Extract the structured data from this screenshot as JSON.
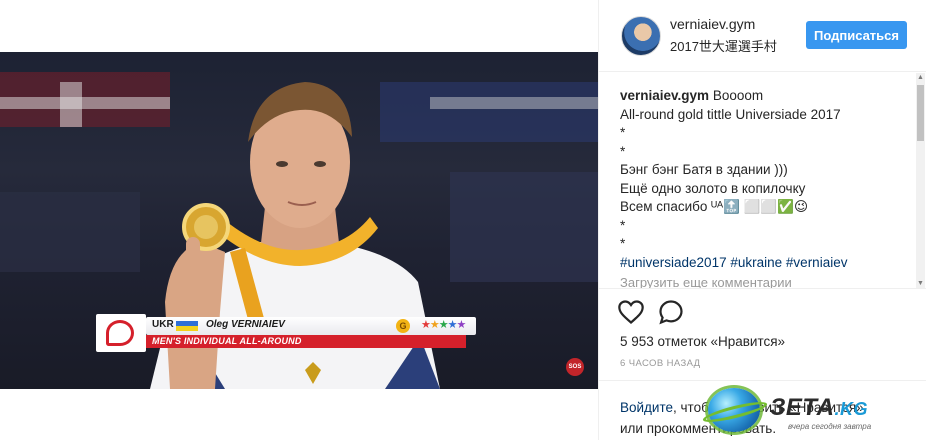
{
  "post": {
    "username": "verniaiev.gym",
    "location": "2017世大運選手村",
    "follow_label": "Подписаться",
    "caption": {
      "user": "verniaiev.gym",
      "first_line": "Boooom",
      "lines": [
        "All-round gold tittle Universiade 2017",
        "*",
        "*",
        "Бэнг бэнг Батя в здании )))",
        "Ещё одно золото в копилочку",
        "Всем спасибо ᵁᴬ🔝 ⬜⬜✅😉",
        "*",
        "*"
      ],
      "hashtags": [
        "#universiade2017",
        "#ukraine",
        "#verniaiev"
      ]
    },
    "load_more": "Загрузить еще комментарии",
    "likes": "5 953 отметок «Нравится»",
    "timestamp": "6 часов назад",
    "login_prompt": {
      "link": "Войдите",
      "text_line1": ", чтобы поставить «Нравится»",
      "text_line2": "или прокомментировать."
    }
  },
  "video": {
    "graphic": {
      "country": "UKR",
      "athlete": "Oleg VERNIAIEV",
      "medal_letter": "G",
      "stars": "★★★★★",
      "event": "MEN'S INDIVIDUAL ALL-AROUND"
    },
    "broadcaster": "SOS"
  },
  "watermark": {
    "brand": "ЗЕТА",
    "tld": ".KG",
    "tagline": "вчера сегодня завтра"
  },
  "colors": {
    "follow_button": "#3897f0",
    "link": "#003569",
    "muted": "#999999",
    "graphic_red": "#d5202b",
    "medal_gold": "#f2b315"
  },
  "icons": [
    "heart-icon",
    "comment-icon",
    "scroll-up-icon",
    "scroll-down-icon",
    "globe-icon",
    "ukraine-flag-icon",
    "star-icon"
  ]
}
